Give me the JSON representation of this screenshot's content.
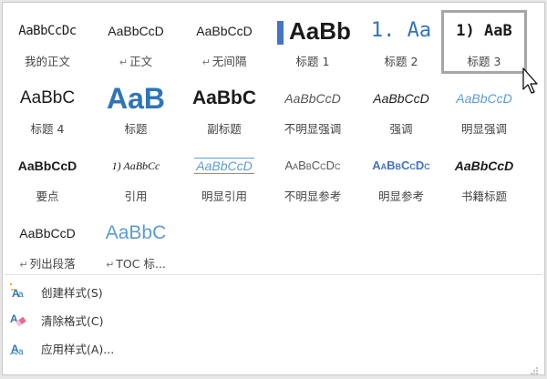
{
  "gallery": {
    "rows": [
      [
        {
          "preview": "AaBbCcDc",
          "caption": "我的正文",
          "para_mark": false,
          "style": "p-normal"
        },
        {
          "preview": "AaBbCcD",
          "caption": "正文",
          "para_mark": true,
          "style": "p-body"
        },
        {
          "preview": "AaBbCcD",
          "caption": "无间隔",
          "para_mark": true,
          "style": "p-nospace"
        },
        {
          "preview": "AaBb",
          "caption": "标题 1",
          "para_mark": false,
          "style": "p-h1"
        },
        {
          "preview": "1. Aa",
          "caption": "标题 2",
          "para_mark": false,
          "style": "p-h2"
        },
        {
          "preview": "1) AaB",
          "caption": "标题 3",
          "para_mark": false,
          "style": "p-h3",
          "selected": true
        }
      ],
      [
        {
          "preview": "AaBbC",
          "caption": "标题 4",
          "para_mark": false,
          "style": "p-h4"
        },
        {
          "preview": "AaB",
          "caption": "标题",
          "para_mark": false,
          "style": "p-title"
        },
        {
          "preview": "AaBbC",
          "caption": "副标题",
          "para_mark": false,
          "style": "p-subtitle"
        },
        {
          "preview": "AaBbCcD",
          "caption": "不明显强调",
          "para_mark": false,
          "style": "p-subtle"
        },
        {
          "preview": "AaBbCcD",
          "caption": "强调",
          "para_mark": false,
          "style": "p-emph"
        },
        {
          "preview": "AaBbCcD",
          "caption": "明显强调",
          "para_mark": false,
          "style": "p-intense"
        }
      ],
      [
        {
          "preview": "AaBbCcD",
          "caption": "要点",
          "para_mark": false,
          "style": "p-strong"
        },
        {
          "preview": "1) AaBbCc",
          "caption": "引用",
          "para_mark": false,
          "style": "p-quote"
        },
        {
          "preview": "AaBbCcD",
          "caption": "明显引用",
          "para_mark": false,
          "style": "p-iquote"
        },
        {
          "preview": "AaBbCcDc",
          "caption": "不明显参考",
          "para_mark": false,
          "style": "p-sref"
        },
        {
          "preview": "AaBbCcDc",
          "caption": "明显参考",
          "para_mark": false,
          "style": "p-iref"
        },
        {
          "preview": "AaBbCcD",
          "caption": "书籍标题",
          "para_mark": false,
          "style": "p-book"
        }
      ],
      [
        {
          "preview": "AaBbCcD",
          "caption": "列出段落",
          "para_mark": true,
          "style": "p-list"
        },
        {
          "preview": "AaBbC",
          "caption": "TOC 标...",
          "para_mark": true,
          "style": "p-toc"
        }
      ]
    ]
  },
  "para_mark_glyph": "↵",
  "commands": [
    {
      "label": "创建样式(S)",
      "icon": "create-style-icon"
    },
    {
      "label": "清除格式(C)",
      "icon": "clear-formatting-icon"
    },
    {
      "label": "应用样式(A)...",
      "icon": "apply-styles-icon"
    }
  ],
  "colors": {
    "accent": "#2e75b6",
    "light_accent": "#5b9bd5",
    "selection_border": "#a6a6a6"
  }
}
